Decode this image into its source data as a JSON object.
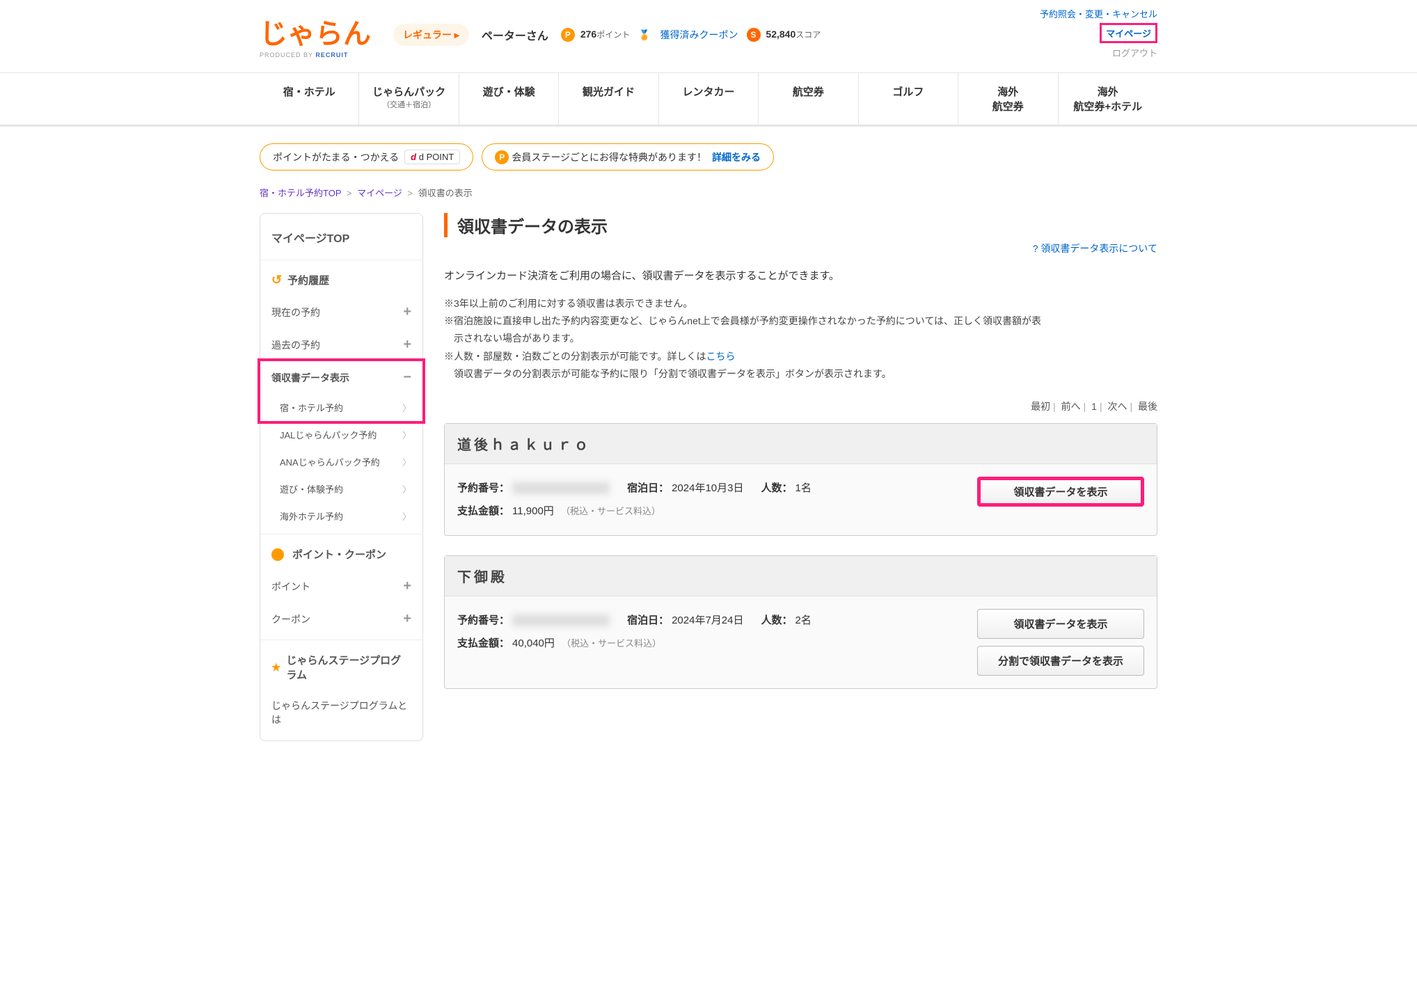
{
  "header": {
    "logo_text": "じゃらん",
    "logo_sub_prefix": "PRODUCED BY ",
    "logo_sub_brand": "RECRUIT",
    "member_rank": "レギュラー ▸",
    "user_name": "ペーターさん",
    "points_badge": "P",
    "points_value": "276",
    "points_label": "ポイント",
    "coupon_text": "獲得済みクーポン",
    "score_badge": "S",
    "score_value": "52,840",
    "score_label": "スコア",
    "link_reservation": "予約照会・変更・キャンセル",
    "link_mypage": "マイページ",
    "link_logout": "ログアウト"
  },
  "gnav": [
    {
      "label": "宿・ホテル",
      "sub": ""
    },
    {
      "label": "じゃらんパック",
      "sub": "（交通＋宿泊）"
    },
    {
      "label": "遊び・体験",
      "sub": ""
    },
    {
      "label": "観光ガイド",
      "sub": ""
    },
    {
      "label": "レンタカー",
      "sub": ""
    },
    {
      "label": "航空券",
      "sub": ""
    },
    {
      "label": "ゴルフ",
      "sub": ""
    },
    {
      "label": "海外\n航空券",
      "sub": ""
    },
    {
      "label": "海外\n航空券+ホテル",
      "sub": ""
    }
  ],
  "pills": {
    "p1_text": "ポイントがたまる・つかえる",
    "p1_dpoint": "d POINT",
    "p2_text": "会員ステージごとにお得な特典があります！",
    "p2_link": "詳細をみる"
  },
  "crumb": {
    "a1": "宿・ホテル予約TOP",
    "a2": "マイページ",
    "cur": "領収書の表示"
  },
  "side": {
    "top": "マイページTOP",
    "history_h": "予約履歴",
    "current": "現在の予約",
    "past": "過去の予約",
    "receipt_h": "領収書データ表示",
    "sub1": "宿・ホテル予約",
    "sub2": "JALじゃらんパック予約",
    "sub3": "ANAじゃらんパック予約",
    "sub4": "遊び・体験予約",
    "sub5": "海外ホテル予約",
    "pc_h": "ポイント・クーポン",
    "pc1": "ポイント",
    "pc2": "クーポン",
    "stage_h": "じゃらんステージプログラム",
    "stage1": "じゃらんステージプログラムとは"
  },
  "main": {
    "title": "領収書データの表示",
    "help": "領収書データ表示について",
    "intro": "オンラインカード決済をご利用の場合に、領収書データを表示することができます。",
    "note1": "※3年以上前のご利用に対する領収書は表示できません。",
    "note2a": "※宿泊施設に直接申し出た予約内容変更など、じゃらんnet上で会員様が予約変更操作されなかった予約については、正しく領収書額が表",
    "note2b": "示されない場合があります。",
    "note3a": "※人数・部屋数・泊数ごとの分割表示が可能です。詳しくは",
    "note3b": "こちら",
    "note4": "領収書データの分割表示が可能な予約に限り「分割で領収書データを表示」ボタンが表示されます。",
    "pager": {
      "first": "最初",
      "prev": "前へ",
      "page": "1",
      "next": "次へ",
      "last": "最後"
    }
  },
  "bookings": [
    {
      "hotel": "道後ｈａｋｕｒｏ",
      "res_no_label": "予約番号：",
      "stay_label": "宿泊日：",
      "stay_date": "2024年10月3日",
      "guests_label": "人数：",
      "guests": "1名",
      "amount_label": "支払金額：",
      "amount": "11,900円",
      "tax_note": "（税込・サービス料込）",
      "btn_show": "領収書データを表示"
    },
    {
      "hotel": "下御殿",
      "res_no_label": "予約番号：",
      "stay_label": "宿泊日：",
      "stay_date": "2024年7月24日",
      "guests_label": "人数：",
      "guests": "2名",
      "amount_label": "支払金額：",
      "amount": "40,040円",
      "tax_note": "（税込・サービス料込）",
      "btn_show": "領収書データを表示",
      "btn_split": "分割で領収書データを表示"
    }
  ]
}
